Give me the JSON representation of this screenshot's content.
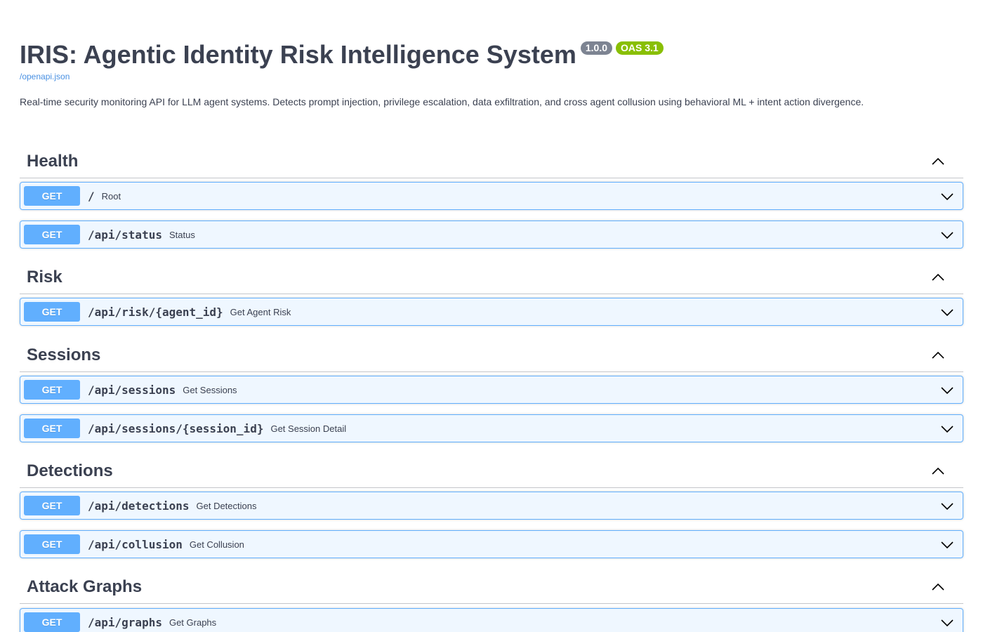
{
  "info": {
    "title": "IRIS: Agentic Identity Risk Intelligence System",
    "version": "1.0.0",
    "oas": "OAS 3.1",
    "spec_link": "/openapi.json",
    "description": "Real-time security monitoring API for LLM agent systems. Detects prompt injection, privilege escalation, data exfiltration, and cross agent collusion using behavioral ML + intent action divergence."
  },
  "colors": {
    "get": "#61affe",
    "text": "#3b4151",
    "link": "#4990e2",
    "version_badge": "#7d8492",
    "oas_badge": "#89bf04"
  },
  "icons": {
    "tag_toggle": "chevron-up-icon",
    "op_toggle": "chevron-down-icon"
  },
  "tags": [
    {
      "name": "Health",
      "operations": [
        {
          "method": "GET",
          "path": "/",
          "summary": "Root"
        },
        {
          "method": "GET",
          "path": "/api/status",
          "summary": "Status"
        }
      ]
    },
    {
      "name": "Risk",
      "operations": [
        {
          "method": "GET",
          "path": "/api/risk/{agent_id}",
          "summary": "Get Agent Risk"
        }
      ]
    },
    {
      "name": "Sessions",
      "operations": [
        {
          "method": "GET",
          "path": "/api/sessions",
          "summary": "Get Sessions"
        },
        {
          "method": "GET",
          "path": "/api/sessions/{session_id}",
          "summary": "Get Session Detail"
        }
      ]
    },
    {
      "name": "Detections",
      "operations": [
        {
          "method": "GET",
          "path": "/api/detections",
          "summary": "Get Detections"
        },
        {
          "method": "GET",
          "path": "/api/collusion",
          "summary": "Get Collusion"
        }
      ]
    },
    {
      "name": "Attack Graphs",
      "operations": [
        {
          "method": "GET",
          "path": "/api/graphs",
          "summary": "Get Graphs"
        }
      ]
    }
  ]
}
